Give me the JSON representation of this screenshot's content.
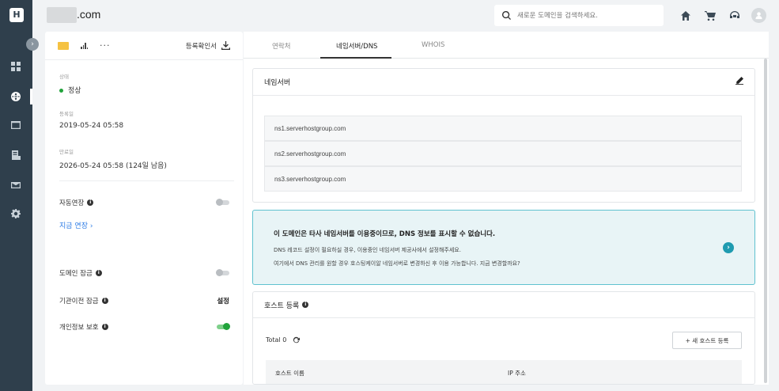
{
  "app": {
    "logo_letter": "H"
  },
  "header": {
    "domain_suffix": ".com",
    "search_placeholder": "새로운 도메인을 검색하세요."
  },
  "left_panel": {
    "cert_label": "등록확인서",
    "status_label": "상태",
    "status_value": "정상",
    "registered_label": "등록일",
    "registered_value": "2019-05-24 05:58",
    "expires_label": "만료일",
    "expires_value": "2026-05-24 05:58 (124일 남음)",
    "auto_renew_label": "자동연장",
    "renew_now_label": "지금 연장  ›",
    "domain_lock_label": "도메인 잠금",
    "registrar_lock_label": "기관이전 잠금",
    "registrar_lock_value": "설정",
    "privacy_label": "개인정보 보호",
    "privacy_enabled": true,
    "auto_renew_enabled": false,
    "domain_lock_enabled": false
  },
  "tabs": [
    "연락처",
    "네임서버/DNS",
    "WHOIS"
  ],
  "active_tab": "네임서버/DNS",
  "nameserver_card": {
    "title": "네임서버",
    "servers": [
      "ns1.serverhostgroup.com",
      "ns2.serverhostgroup.com",
      "ns3.serverhostgroup.com"
    ]
  },
  "notice": {
    "title": "이 도메인은 타사 네임서버를 이용중이므로, DNS 정보를 표시할 수 없습니다.",
    "line1": "DNS 레코드 설정이 필요하실 경우, 이용중인 네임서버 제공사에서 설정해주세요.",
    "line2": "여기에서 DNS 관리를 원할 경우 호스팅케이알 네임서버로 변경하신 후 이용 가능합니다. 지금 변경할까요?"
  },
  "host_card": {
    "title": "호스트 등록",
    "total_label": "Total 0",
    "new_button": "+ 새 호스트 등록",
    "col_hostname": "호스트 이름",
    "col_ip": "IP 주소"
  },
  "colors": {
    "rail_bg": "#2f3f4c",
    "accent_link": "#2c7be5",
    "status_green": "#21a33b",
    "notice_border": "#5fc2cf",
    "notice_bg": "#e8f4f6"
  }
}
